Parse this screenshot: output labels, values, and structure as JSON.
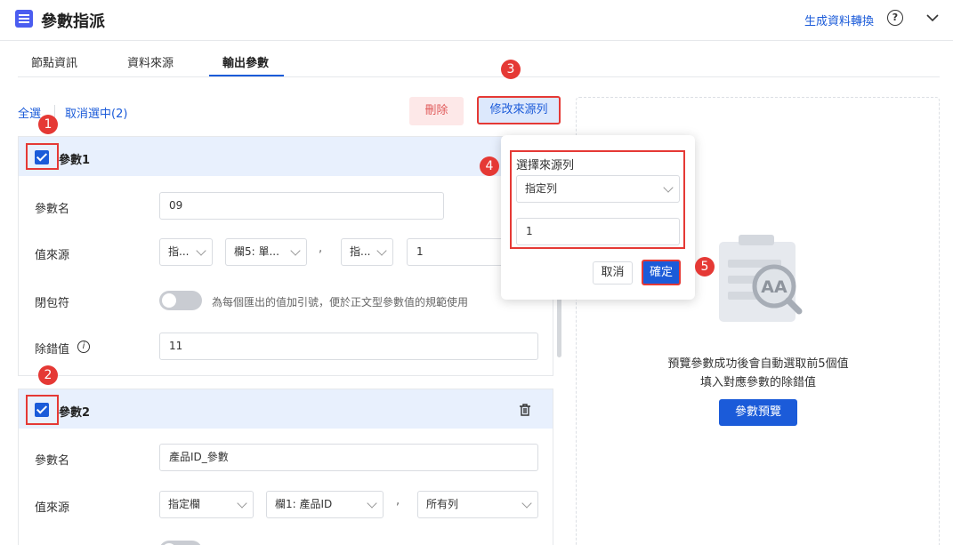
{
  "header": {
    "title": "參數指派",
    "link_label": "生成資料轉換",
    "help_glyph": "?"
  },
  "tabs": [
    {
      "label": "節點資訊"
    },
    {
      "label": "資料來源"
    },
    {
      "label": "輸出參數"
    }
  ],
  "toolbar": {
    "select_all": "全選",
    "deselect": "取消選中(2)",
    "delete_label": "刪除",
    "modify_source_label": "修改來源列"
  },
  "params": [
    {
      "title": "參數1",
      "name_label": "參數名",
      "name_value": "09",
      "source_label": "值來源",
      "source_type": "指...",
      "source_column": "欄5: 單...",
      "source_sep": ",",
      "row_type": "指...",
      "row_value": "1",
      "wrap_label": "閉包符",
      "wrap_hint": "為每個匯出的值加引號，便於正文型參數值的規範使用",
      "debug_label": "除錯值",
      "debug_value": "11",
      "info_glyph": "i"
    },
    {
      "title": "參數2",
      "name_label": "參數名",
      "name_value": "產品ID_參數",
      "source_label": "值來源",
      "source_type": "指定欄",
      "source_column": "欄1: 產品ID",
      "source_sep": ",",
      "row_type": "所有列"
    }
  ],
  "popup": {
    "label": "選擇來源列",
    "select_value": "指定列",
    "input_value": "1",
    "cancel_label": "取消",
    "ok_label": "確定"
  },
  "right_panel": {
    "message_line1": "預覽參數成功後會自動選取前5個值",
    "message_line2": "填入對應參數的除錯值",
    "preview_label": "參數預覽",
    "illustration_text": "AA"
  },
  "markers": [
    "1",
    "2",
    "3",
    "4",
    "5"
  ],
  "colors": {
    "accent": "#1b5bd9",
    "marker": "#e53935",
    "delete_bg": "#fde8e8",
    "card_head": "#e8f0fd"
  }
}
